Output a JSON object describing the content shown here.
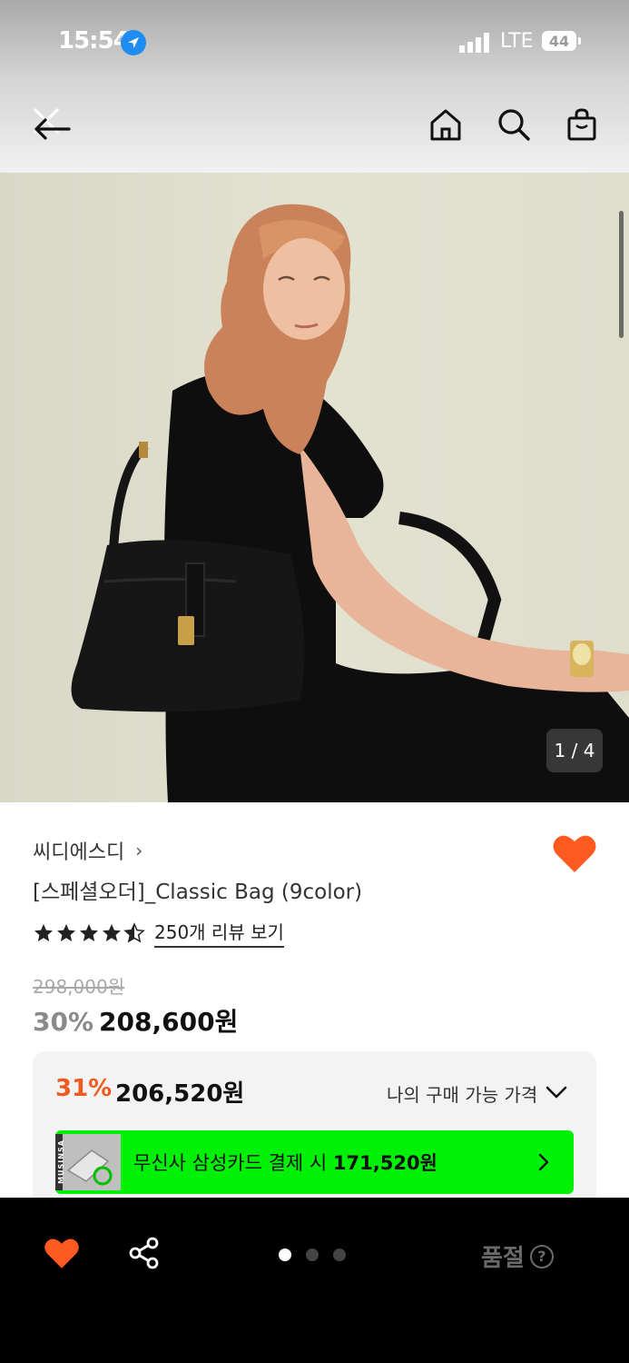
{
  "status_bar": {
    "time": "15:54",
    "network": "LTE",
    "battery": "44"
  },
  "header": {
    "back_icon": "back-arrow-icon",
    "home_icon": "home-icon",
    "search_icon": "search-icon",
    "cart_icon": "shopping-bag-icon"
  },
  "gallery": {
    "page_counter": "1 / 4"
  },
  "product": {
    "brand": "씨디에스디",
    "brand_chevron": "›",
    "name": "[스페셜오더]_Classic Bag (9color)",
    "rating": 4.5,
    "review_link": "250개 리뷰 보기",
    "original_price": "298,000원",
    "discount_rate": "30%",
    "sale_price": "208,600원",
    "liked": true
  },
  "benefit": {
    "my_discount_rate": "31%",
    "my_price": "206,520원",
    "my_price_label": "나의 구매 가능 가격",
    "card_thumb_text": "MUSINSA",
    "card_text_prefix": "무신사 삼성카드 결제 시 ",
    "card_price": "171,520원"
  },
  "bottom_bar": {
    "soldout_label": "품절",
    "help_symbol": "?",
    "carousel_dots": 3,
    "active_dot": 0
  },
  "colors": {
    "accent_orange": "#ff5a1f",
    "card_green": "#00f008",
    "discount_orange": "#f05a1e"
  }
}
